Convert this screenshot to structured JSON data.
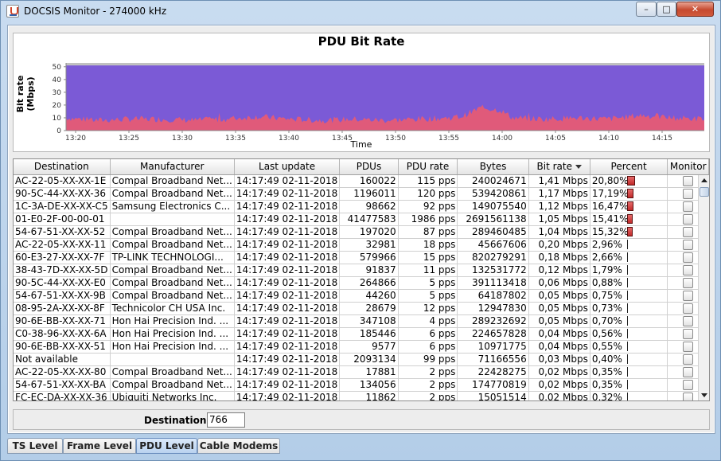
{
  "window": {
    "title": "DOCSIS Monitor - 274000 kHz",
    "minimize_glyph": "–",
    "maximize_glyph": "□",
    "close_glyph": "✕"
  },
  "chart_data": {
    "type": "area",
    "title": "PDU Bit Rate",
    "xlabel": "Time",
    "ylabel": "Bit rate (Mbps)",
    "ylim": [
      0,
      50
    ],
    "yticks": [
      "0",
      "10",
      "20",
      "30",
      "40",
      "50"
    ],
    "xticks": [
      "13:20",
      "13:25",
      "13:30",
      "13:35",
      "13:40",
      "13:45",
      "13:50",
      "13:55",
      "14:00",
      "14:05",
      "14:10",
      "14:15"
    ],
    "series": [
      {
        "values_note_color": "#7b5ad6",
        "color": "#7b5ad6",
        "constant_value": 51
      },
      {
        "color": "#e05a7a",
        "x": [
          0,
          0.05,
          0.1,
          0.15,
          0.2,
          0.25,
          0.3,
          0.35,
          0.4,
          0.45,
          0.5,
          0.55,
          0.6,
          0.62,
          0.65,
          0.68,
          0.7,
          0.75,
          0.8,
          0.85,
          0.9,
          0.95,
          1.0
        ],
        "values": [
          10,
          8,
          9,
          9,
          8,
          9,
          11,
          9,
          8,
          9,
          8,
          9,
          10,
          11,
          18,
          16,
          10,
          9,
          10,
          9,
          12,
          10,
          9
        ]
      }
    ]
  },
  "table": {
    "columns": [
      "Destination",
      "Manufacturer",
      "Last update",
      "PDUs",
      "PDU rate",
      "Bytes",
      "Bit rate",
      "Percent",
      "Monitor"
    ],
    "rows": [
      [
        "AC-22-05-XX-XX-1E",
        "Compal Broadband Net...",
        "14:17:49  02-11-2018",
        "160022",
        "115 pps",
        "240024671",
        "1,41 Mbps",
        "20,80%",
        20.8
      ],
      [
        "90-5C-44-XX-XX-36",
        "Compal Broadband Net...",
        "14:17:49  02-11-2018",
        "1196011",
        "120 pps",
        "539420861",
        "1,17 Mbps",
        "17,19%",
        17.19
      ],
      [
        "1C-3A-DE-XX-XX-C5",
        "Samsung Electronics C...",
        "14:17:49  02-11-2018",
        "98662",
        "92 pps",
        "149075540",
        "1,12 Mbps",
        "16,47%",
        16.47
      ],
      [
        "01-E0-2F-00-00-01",
        "",
        "14:17:49  02-11-2018",
        "41477583",
        "1986 pps",
        "2691561138",
        "1,05 Mbps",
        "15,41%",
        15.41
      ],
      [
        "54-67-51-XX-XX-52",
        "Compal Broadband Net...",
        "14:17:49  02-11-2018",
        "197020",
        "87 pps",
        "289460485",
        "1,04 Mbps",
        "15,32%",
        15.32
      ],
      [
        "AC-22-05-XX-XX-11",
        "Compal Broadband Net...",
        "14:17:49  02-11-2018",
        "32981",
        "18 pps",
        "45667606",
        "0,20 Mbps",
        "2,96%",
        2.96
      ],
      [
        "60-E3-27-XX-XX-7F",
        "TP-LINK TECHNOLOGI...",
        "14:17:49  02-11-2018",
        "579966",
        "15 pps",
        "820279291",
        "0,18 Mbps",
        "2,66%",
        2.66
      ],
      [
        "38-43-7D-XX-XX-5D",
        "Compal Broadband Net...",
        "14:17:49  02-11-2018",
        "91837",
        "11 pps",
        "132531772",
        "0,12 Mbps",
        "1,79%",
        1.79
      ],
      [
        "90-5C-44-XX-XX-E0",
        "Compal Broadband Net...",
        "14:17:49  02-11-2018",
        "264866",
        "5 pps",
        "391113418",
        "0,06 Mbps",
        "0,88%",
        0.88
      ],
      [
        "54-67-51-XX-XX-9B",
        "Compal Broadband Net...",
        "14:17:49  02-11-2018",
        "44260",
        "5 pps",
        "64187802",
        "0,05 Mbps",
        "0,75%",
        0.75
      ],
      [
        "08-95-2A-XX-XX-8F",
        "Technicolor CH USA Inc.",
        "14:17:49  02-11-2018",
        "28679",
        "12 pps",
        "12947830",
        "0,05 Mbps",
        "0,73%",
        0.73
      ],
      [
        "90-6E-BB-XX-XX-71",
        "Hon Hai Precision Ind. ...",
        "14:17:49  02-11-2018",
        "347108",
        "4 pps",
        "289232692",
        "0,05 Mbps",
        "0,70%",
        0.7
      ],
      [
        "C0-38-96-XX-XX-6A",
        "Hon Hai Precision Ind. ...",
        "14:17:49  02-11-2018",
        "185446",
        "6 pps",
        "224657828",
        "0,04 Mbps",
        "0,56%",
        0.56
      ],
      [
        "90-6E-BB-XX-XX-51",
        "Hon Hai Precision Ind. ...",
        "14:17:49  02-11-2018",
        "9577",
        "6 pps",
        "10971775",
        "0,04 Mbps",
        "0,55%",
        0.55
      ],
      [
        "Not available",
        "",
        "14:17:49  02-11-2018",
        "2093134",
        "99 pps",
        "71166556",
        "0,03 Mbps",
        "0,40%",
        0.4
      ],
      [
        "AC-22-05-XX-XX-80",
        "Compal Broadband Net...",
        "14:17:49  02-11-2018",
        "17881",
        "2 pps",
        "22428275",
        "0,02 Mbps",
        "0,35%",
        0.35
      ],
      [
        "54-67-51-XX-XX-BA",
        "Compal Broadband Net...",
        "14:17:49  02-11-2018",
        "134056",
        "2 pps",
        "174770819",
        "0,02 Mbps",
        "0,35%",
        0.35
      ],
      [
        "FC-EC-DA-XX-XX-36",
        "Ubiquiti Networks Inc.",
        "14:17:49  02-11-2018",
        "11862",
        "2 pps",
        "15051514",
        "0,02 Mbps",
        "0,32%",
        0.32
      ]
    ]
  },
  "footer": {
    "destinations_label": "Destinations:",
    "destinations_value": "766"
  },
  "tabs": [
    {
      "label": "TS Level",
      "active": false
    },
    {
      "label": "Frame Level",
      "active": false
    },
    {
      "label": "PDU Level",
      "active": true
    },
    {
      "label": "Cable Modems",
      "active": false
    }
  ]
}
